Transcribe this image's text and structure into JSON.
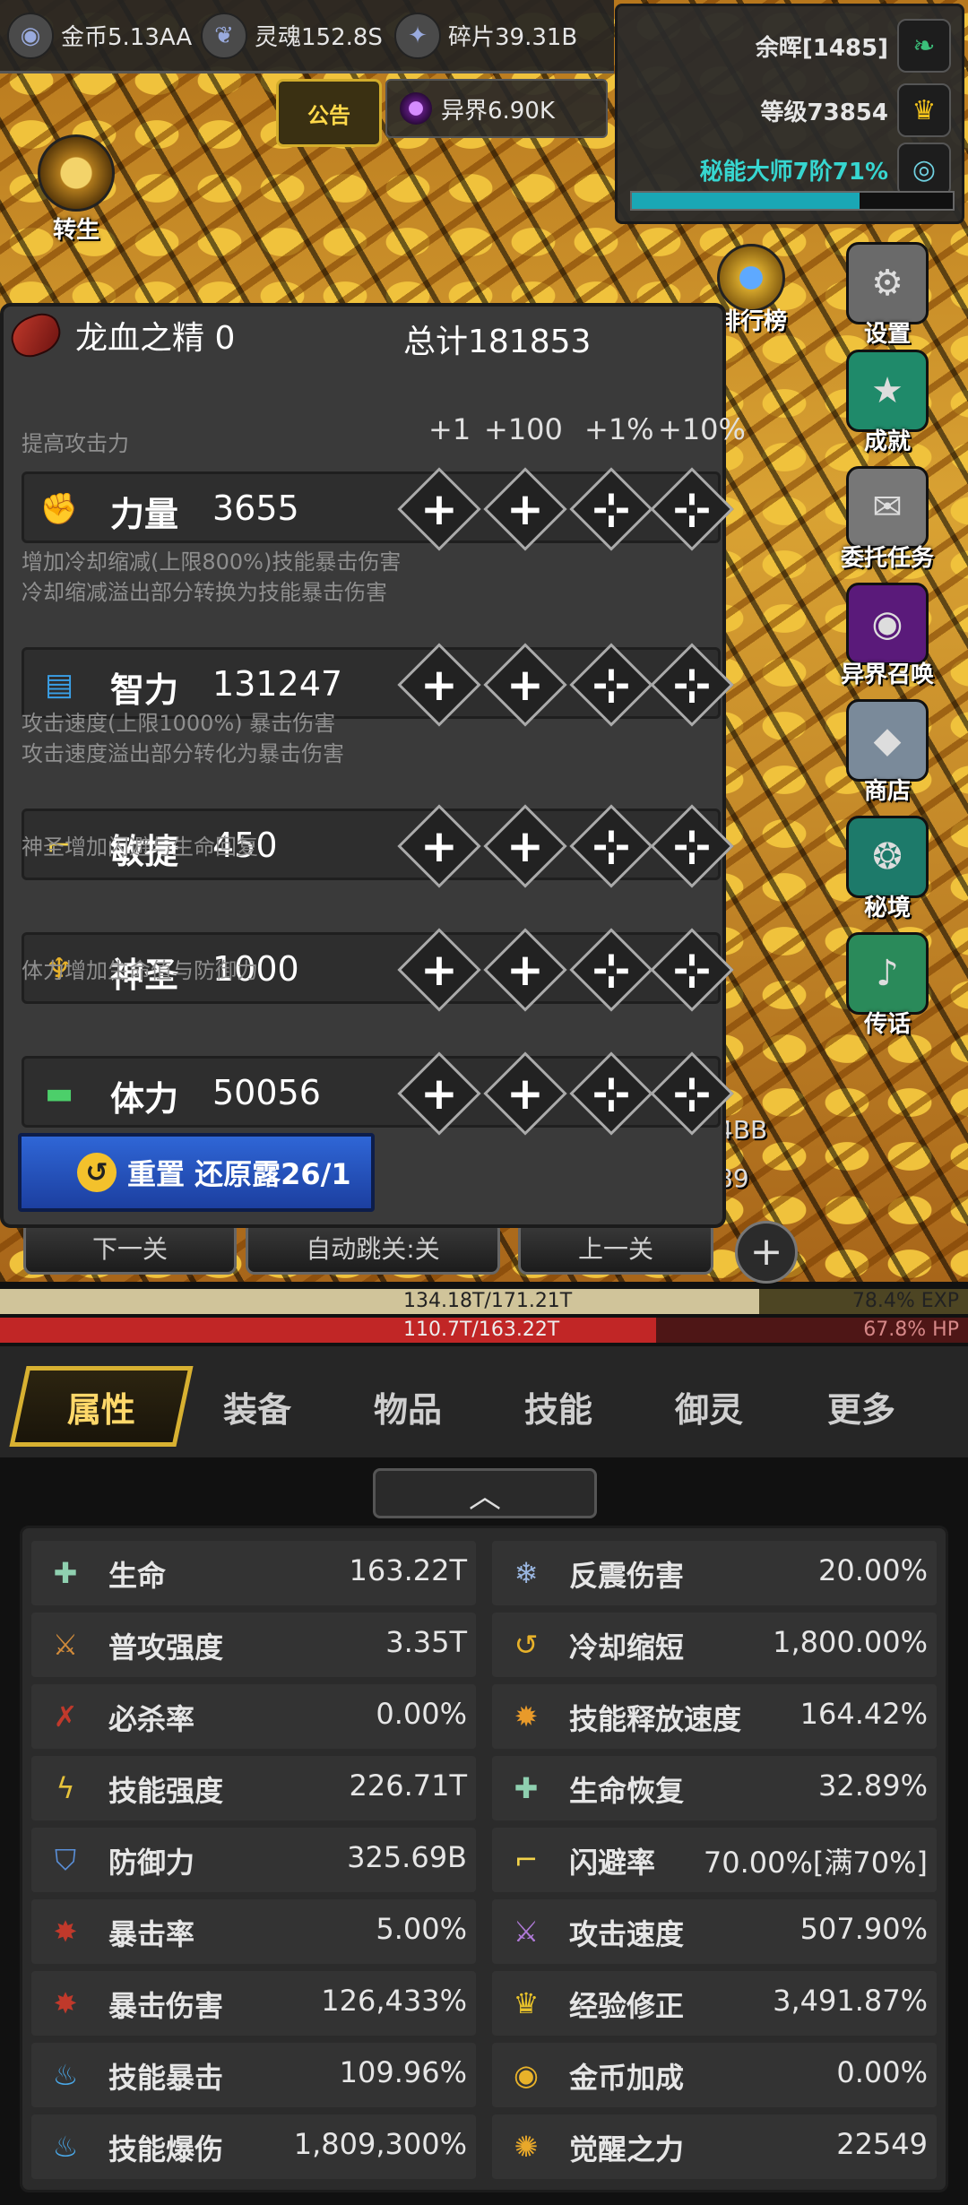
{
  "resources": [
    {
      "label": "金币5.13AA",
      "icon": "coin-icon"
    },
    {
      "label": "灵魂152.8S",
      "icon": "soul-icon"
    },
    {
      "label": "碎片39.31B",
      "icon": "fragment-icon"
    }
  ],
  "notice_label": "公告",
  "otherworld_label": "异界6.90K",
  "afterglow_label": "余晖[1485]",
  "level_label": "等级73854",
  "mastery_label": "秘能大师7阶71%",
  "mastery_progress": 0.71,
  "left_side": {
    "reincarnate_label": "转生"
  },
  "right_side": [
    {
      "label": "设置",
      "icon": "gear-icon"
    },
    {
      "label": "成就",
      "icon": "star-icon"
    },
    {
      "label": "委托任务",
      "icon": "envelope-icon"
    },
    {
      "label": "异界召唤",
      "icon": "portal-icon"
    },
    {
      "label": "商店",
      "icon": "gem-icon"
    },
    {
      "label": "秘境",
      "icon": "mystic-icon"
    },
    {
      "label": "传话",
      "icon": "horn-icon"
    }
  ],
  "rank_label": "排行榜",
  "peek_values": [
    "4BB",
    "89"
  ],
  "stage_buttons": {
    "next": "下一关",
    "auto_skip": "自动跳关:关",
    "prev": "上一关"
  },
  "alloc": {
    "essence_label": "龙血之精 0",
    "total_label": "总计181853",
    "increments": [
      "+1",
      "+100",
      "+1%",
      "+10%"
    ],
    "stats": [
      {
        "hint": "提高攻击力",
        "name": "力量",
        "value": "3655",
        "icon": "strength-icon",
        "color": "#f28a3c"
      },
      {
        "hint": "增加冷却缩减(上限800%)技能暴击伤害\n冷却缩减溢出部分转换为技能暴击伤害",
        "name": "智力",
        "value": "131247",
        "icon": "book-icon",
        "color": "#3aa0e8"
      },
      {
        "hint": "攻击速度(上限1000%) 暴击伤害\n攻击速度溢出部分转化为暴击伤害",
        "name": "敏捷",
        "value": "450",
        "icon": "boot-icon",
        "color": "#f3d34a"
      },
      {
        "hint": "神圣增加闪避与生命回复",
        "name": "神圣",
        "value": "1000",
        "icon": "chalice-icon",
        "color": "#e8b22a"
      },
      {
        "hint": "体力增加生命值与防御力",
        "name": "体力",
        "value": "50056",
        "icon": "bandage-icon",
        "color": "#4ccf6a"
      }
    ],
    "reset_label": "重置 还原露26/1"
  },
  "exp": {
    "text": "134.18T/171.21T",
    "pct_label": "78.4% EXP",
    "fraction": 0.784
  },
  "hp": {
    "text": "110.7T/163.22T",
    "pct_label": "67.8% HP",
    "fraction": 0.678
  },
  "tabs": [
    "属性",
    "装备",
    "物品",
    "技能",
    "御灵",
    "更多"
  ],
  "active_tab": 0,
  "attributes_left": [
    {
      "name": "生命",
      "value": "163.22T",
      "icon": "life-cross-icon",
      "color": "#8fd0b0"
    },
    {
      "name": "普攻强度",
      "value": "3.35T",
      "icon": "sword-icon",
      "color": "#d08a3a"
    },
    {
      "name": "必杀率",
      "value": "0.00%",
      "icon": "slash-icon",
      "color": "#c0392b"
    },
    {
      "name": "技能强度",
      "value": "226.71T",
      "icon": "lightning-icon",
      "color": "#e6c23a"
    },
    {
      "name": "防御力",
      "value": "325.69B",
      "icon": "shield-icon",
      "color": "#5a8fd8"
    },
    {
      "name": "暴击率",
      "value": "5.00%",
      "icon": "crit-rate-icon",
      "color": "#c0392b"
    },
    {
      "name": "暴击伤害",
      "value": "126,433%",
      "icon": "crit-damage-icon",
      "color": "#c0392b"
    },
    {
      "name": "技能暴击",
      "value": "109.96%",
      "icon": "blue-flame-icon",
      "color": "#4aa8e8"
    },
    {
      "name": "技能爆伤",
      "value": "1,809,300%",
      "icon": "blue-flame-icon",
      "color": "#4aa8e8"
    }
  ],
  "attributes_right": [
    {
      "name": "反震伤害",
      "value": "20.00%",
      "icon": "shatter-icon",
      "color": "#9ab6e0"
    },
    {
      "name": "冷却缩短",
      "value": "1,800.00%",
      "icon": "cooldown-icon",
      "color": "#e8b22a"
    },
    {
      "name": "技能释放速度",
      "value": "164.42%",
      "icon": "cast-speed-icon",
      "color": "#e89a2a"
    },
    {
      "name": "生命恢复",
      "value": "32.89%",
      "icon": "regen-icon",
      "color": "#8fd0b0"
    },
    {
      "name": "闪避率",
      "value": "70.00%[满70%]",
      "icon": "dodge-boot-icon",
      "color": "#f3d34a"
    },
    {
      "name": "攻击速度",
      "value": "507.90%",
      "icon": "attack-speed-icon",
      "color": "#b07ad8"
    },
    {
      "name": "经验修正",
      "value": "3,491.87%",
      "icon": "crown-icon",
      "color": "#e8c22a"
    },
    {
      "name": "金币加成",
      "value": "0.00%",
      "icon": "coin-bonus-icon",
      "color": "#e8b22a"
    },
    {
      "name": "觉醒之力",
      "value": "22549",
      "icon": "awaken-icon",
      "color": "#e8a82a"
    }
  ]
}
